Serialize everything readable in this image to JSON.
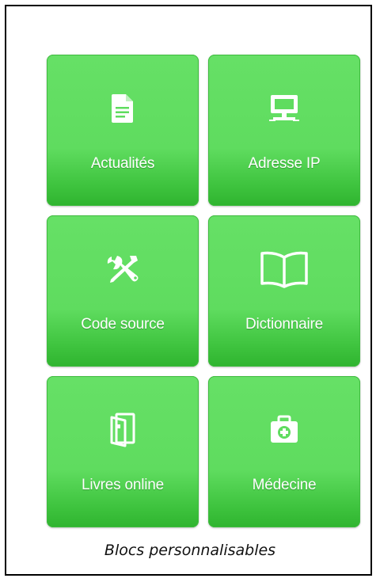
{
  "tiles": [
    {
      "label": "Actualités",
      "icon": "document-icon"
    },
    {
      "label": "Adresse IP",
      "icon": "computer-icon"
    },
    {
      "label": "Code source",
      "icon": "tools-icon"
    },
    {
      "label": "Dictionnaire",
      "icon": "open-book-icon"
    },
    {
      "label": "Livres online",
      "icon": "book-icon"
    },
    {
      "label": "Médecine",
      "icon": "medical-kit-icon"
    }
  ],
  "caption": "Blocs personnalisables",
  "colors": {
    "tile_green": "#5fdc5f",
    "tile_green_dark": "#2fb42f",
    "label_text": "#ffffff"
  }
}
